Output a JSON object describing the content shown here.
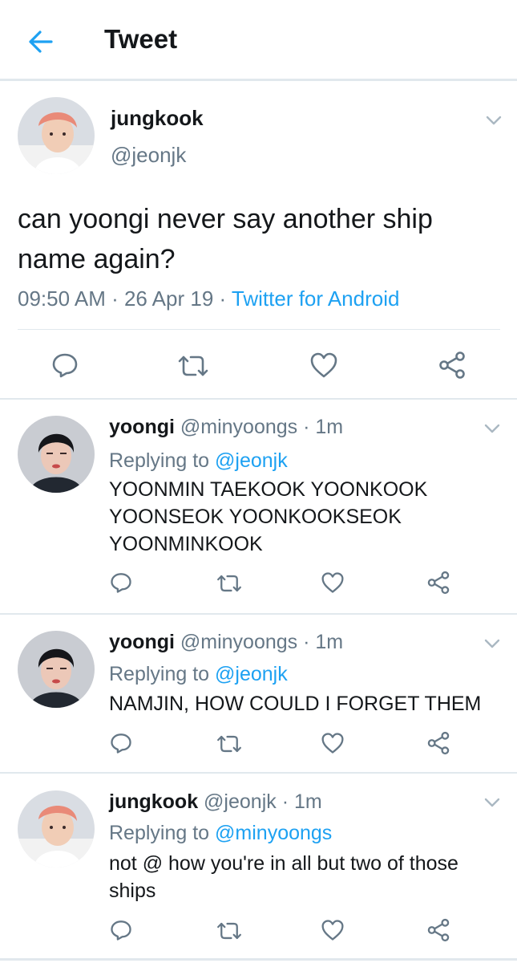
{
  "header": {
    "title": "Tweet"
  },
  "main_tweet": {
    "name": "jungkook",
    "handle": "@jeonjk",
    "text": "can yoongi never say another ship name again?",
    "time": "09:50 AM",
    "sep1": " · ",
    "date": "26 Apr 19",
    "sep2": " · ",
    "source": "Twitter for Android"
  },
  "replies": [
    {
      "name": "yoongi",
      "handle": " @minyoongs · 1m",
      "replying_prefix": "Replying to ",
      "replying_to": "@jeonjk",
      "text": "YOONMIN TAEKOOK YOONKOOK YOONSEOK YOONKOOKSEOK YOONMINKOOK"
    },
    {
      "name": "yoongi",
      "handle": " @minyoongs · 1m",
      "replying_prefix": "Replying to ",
      "replying_to": "@jeonjk",
      "text": "NAMJIN, HOW COULD I FORGET THEM"
    },
    {
      "name": "jungkook",
      "handle": " @jeonjk · 1m",
      "replying_prefix": "Replying to ",
      "replying_to": "@minyoongs",
      "text": "not @ how you're in all but two of those ships"
    }
  ],
  "colors": {
    "accent": "#1da1f2",
    "secondary_text": "#657786",
    "divider": "#e1e8ed"
  },
  "icons": [
    "back-arrow-icon",
    "chevron-down-icon",
    "reply-icon",
    "retweet-icon",
    "like-icon",
    "share-icon"
  ]
}
